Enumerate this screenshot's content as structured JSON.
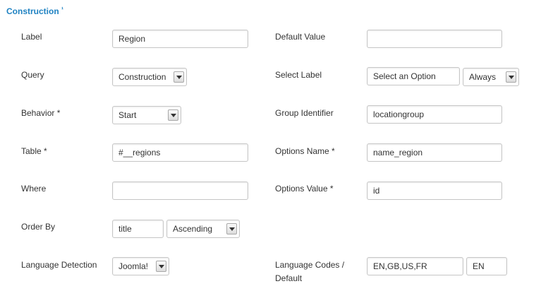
{
  "section": {
    "title": "Construction",
    "title_marker": "¹"
  },
  "left": {
    "label": {
      "label": "Label",
      "value": "Region"
    },
    "query": {
      "label": "Query",
      "value": "Construction"
    },
    "behavior": {
      "label": "Behavior *",
      "value": "Start"
    },
    "table": {
      "label": "Table *",
      "value": "#__regions"
    },
    "where": {
      "label": "Where",
      "value": ""
    },
    "order_by": {
      "label": "Order By",
      "value": "title",
      "direction": "Ascending"
    },
    "language_detection": {
      "label": "Language Detection",
      "value": "Joomla!"
    }
  },
  "right": {
    "default_value": {
      "label": "Default Value",
      "value": ""
    },
    "select_label": {
      "label": "Select Label",
      "value": "Select an Option",
      "mode": "Always"
    },
    "group_identifier": {
      "label": "Group Identifier",
      "value": "locationgroup"
    },
    "options_name": {
      "label": "Options Name *",
      "value": "name_region"
    },
    "options_value": {
      "label": "Options Value *",
      "value": "id"
    },
    "language_codes": {
      "label_line1": "Language Codes /",
      "label_line2": "Default",
      "value": "EN,GB,US,FR",
      "default": "EN"
    }
  }
}
